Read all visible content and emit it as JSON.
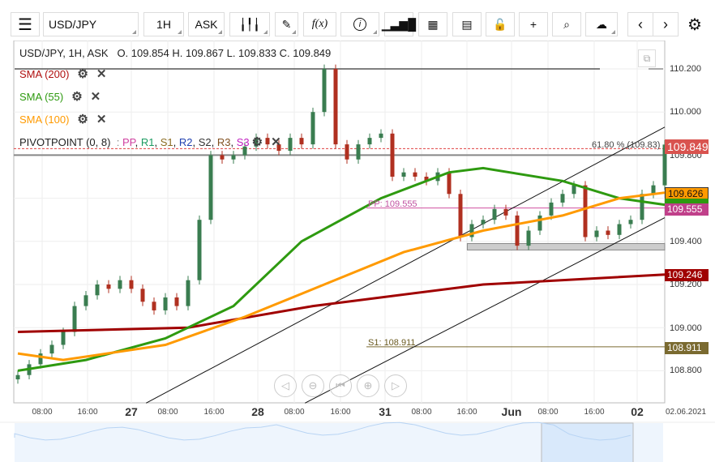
{
  "toolbar": {
    "menu": "menu-icon",
    "symbol": "USD/JPY",
    "interval": "1H",
    "price_type": "ASK",
    "fx": "f(x)",
    "info": "i"
  },
  "header": {
    "summary": "USD/JPY, 1H, ASK",
    "ohlc": "O. 109.854 H. 109.867 L. 109.833 C. 109.849"
  },
  "indicators": [
    {
      "label": "SMA (200)",
      "color": "#b01010"
    },
    {
      "label": "SMA (55)",
      "color": "#2e9a10"
    },
    {
      "label": "SMA (100)",
      "color": "#ff9a00"
    }
  ],
  "pivot": {
    "label": "PIVOTPOINT (0, 8)",
    "sep": ":",
    "pp": "PP",
    "r1": "R1",
    "s1": "S1",
    "r2": "R2",
    "s2": "S2",
    "r3": "R3",
    "s3": "S3"
  },
  "annotations": {
    "fib": "61.80 % (109.83)",
    "pp": "PP: 109.555",
    "s1": "S1: 108.911"
  },
  "price_axis": [
    "110.200",
    "110.000",
    "109.800",
    "109.400",
    "109.200",
    "109.000",
    "108.800"
  ],
  "badges": {
    "last": "109.849",
    "sma100": "109.626",
    "pp": "109.555",
    "sma200": "109.246",
    "s1": "108.911"
  },
  "time_axis": [
    {
      "t": "08:00"
    },
    {
      "t": "16:00"
    },
    {
      "t": "27",
      "big": true
    },
    {
      "t": "08:00"
    },
    {
      "t": "16:00"
    },
    {
      "t": "28",
      "big": true
    },
    {
      "t": "08:00"
    },
    {
      "t": "16:00"
    },
    {
      "t": "31",
      "big": true
    },
    {
      "t": "08:00"
    },
    {
      "t": "16:00"
    },
    {
      "t": "Jun",
      "big": true
    },
    {
      "t": "08:00"
    },
    {
      "t": "16:00"
    },
    {
      "t": "02",
      "big": true
    }
  ],
  "date_label": "02.06.2021",
  "chart_data": {
    "type": "candlestick",
    "ylim": [
      108.7,
      110.3
    ],
    "closes": [
      108.78,
      108.83,
      108.88,
      108.92,
      108.98,
      109.1,
      109.15,
      109.2,
      109.18,
      109.22,
      109.18,
      109.12,
      109.08,
      109.14,
      109.1,
      109.22,
      109.5,
      109.8,
      109.78,
      109.8,
      109.84,
      109.88,
      109.85,
      109.82,
      109.88,
      109.85,
      110.0,
      110.2,
      109.85,
      109.78,
      109.85,
      109.88,
      109.9,
      109.7,
      109.72,
      109.7,
      109.68,
      109.72,
      109.62,
      109.42,
      109.48,
      109.5,
      109.55,
      109.52,
      109.38,
      109.45,
      109.52,
      109.58,
      109.62,
      109.66,
      109.42,
      109.45,
      109.43,
      109.48,
      109.5,
      109.62,
      109.66,
      109.849
    ],
    "sma200": [
      [
        0,
        108.98
      ],
      [
        15,
        109.0
      ],
      [
        26,
        109.1
      ],
      [
        41,
        109.2
      ],
      [
        57,
        109.246
      ]
    ],
    "sma55": [
      [
        0,
        108.8
      ],
      [
        6,
        108.85
      ],
      [
        13,
        108.95
      ],
      [
        19,
        109.1
      ],
      [
        25,
        109.4
      ],
      [
        32,
        109.6
      ],
      [
        38,
        109.72
      ],
      [
        41,
        109.74
      ],
      [
        48,
        109.68
      ],
      [
        53,
        109.6
      ],
      [
        57,
        109.57
      ]
    ],
    "sma100": [
      [
        0,
        108.88
      ],
      [
        4,
        108.85
      ],
      [
        13,
        108.92
      ],
      [
        20,
        109.05
      ],
      [
        27,
        109.2
      ],
      [
        34,
        109.35
      ],
      [
        41,
        109.45
      ],
      [
        48,
        109.52
      ],
      [
        53,
        109.6
      ],
      [
        57,
        109.626
      ]
    ],
    "trendlines": [
      [
        [
          11.3,
          108.65
        ],
        [
          57,
          109.93
        ]
      ],
      [
        [
          25.3,
          108.65
        ],
        [
          57,
          109.51
        ]
      ]
    ],
    "zone": [
      39.6,
      57,
      109.36,
      109.39
    ],
    "levels": {
      "hline": 110.2,
      "fib": 109.83,
      "fib_base": 109.8,
      "pp": 109.555,
      "s1": 108.911
    }
  }
}
